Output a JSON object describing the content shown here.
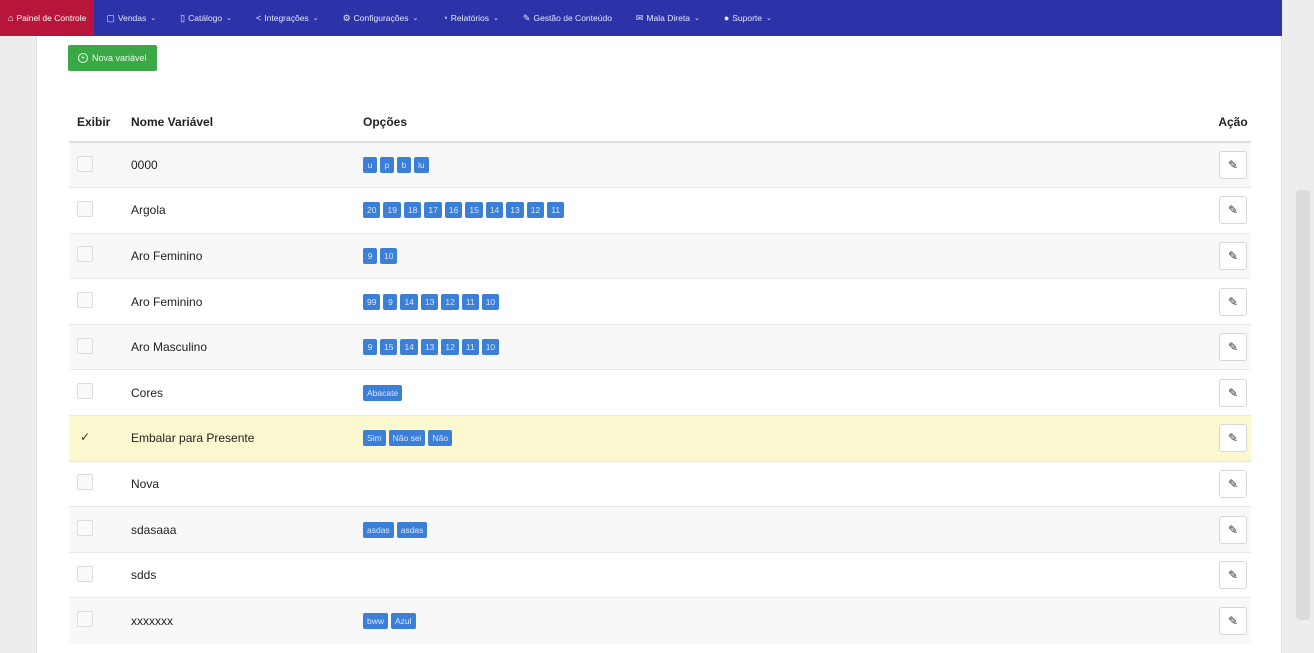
{
  "nav": [
    {
      "label": "Painel de Controle",
      "icon": "⌂",
      "icon_name": "home-icon",
      "active": true,
      "dropdown": false
    },
    {
      "label": "Vendas",
      "icon": "▢",
      "icon_name": "cart-icon",
      "active": false,
      "dropdown": true
    },
    {
      "label": "Catálogo",
      "icon": "▯",
      "icon_name": "book-icon",
      "active": false,
      "dropdown": true
    },
    {
      "label": "Integrações",
      "icon": "<",
      "icon_name": "share-icon",
      "active": false,
      "dropdown": true
    },
    {
      "label": "Configurações",
      "icon": "⚙",
      "icon_name": "gear-icon",
      "active": false,
      "dropdown": true
    },
    {
      "label": "Relatórios",
      "icon": "◔",
      "icon_name": "chart-icon",
      "active": false,
      "dropdown": true
    },
    {
      "label": "Gestão de Conteúdo",
      "icon": "✎",
      "icon_name": "edit-square-icon",
      "active": false,
      "dropdown": false
    },
    {
      "label": "Mala Direta",
      "icon": "✉",
      "icon_name": "mail-icon",
      "active": false,
      "dropdown": true
    },
    {
      "label": "Suporte",
      "icon": "●",
      "icon_name": "support-icon",
      "active": false,
      "dropdown": true
    }
  ],
  "new_button_label": "Nova variável",
  "table": {
    "headers": {
      "exibir": "Exibir",
      "nome": "Nome Variável",
      "opcoes": "Opções",
      "acao": "Ação"
    },
    "rows": [
      {
        "checked": false,
        "name": "0000",
        "options": [
          "u",
          "p",
          "b",
          "lu"
        ]
      },
      {
        "checked": false,
        "name": "Argola",
        "options": [
          "20",
          "19",
          "18",
          "17",
          "16",
          "15",
          "14",
          "13",
          "12",
          "11"
        ]
      },
      {
        "checked": false,
        "name": "Aro Feminino",
        "options": [
          "9",
          "10"
        ]
      },
      {
        "checked": false,
        "name": "Aro Feminino",
        "options": [
          "99",
          "9",
          "14",
          "13",
          "12",
          "11",
          "10"
        ]
      },
      {
        "checked": false,
        "name": "Aro Masculino",
        "options": [
          "9",
          "15",
          "14",
          "13",
          "12",
          "11",
          "10"
        ]
      },
      {
        "checked": false,
        "name": "Cores",
        "options": [
          "Abacate"
        ]
      },
      {
        "checked": true,
        "highlight": true,
        "name": "Embalar para Presente",
        "options": [
          "Sim",
          "Não sei",
          "Não"
        ]
      },
      {
        "checked": false,
        "name": "Nova",
        "options": []
      },
      {
        "checked": false,
        "name": "sdasaaa",
        "options": [
          "asdas",
          "asdas"
        ]
      },
      {
        "checked": false,
        "name": "sdds",
        "options": []
      },
      {
        "checked": false,
        "name": "xxxxxxx",
        "options": [
          "bww",
          "Azul"
        ]
      }
    ]
  },
  "colors": {
    "nav_bg": "#2c32a8",
    "nav_active": "#b7153b",
    "chip": "#3b7fd6",
    "new_button": "#3aa844",
    "highlight_row": "#fbf8d0"
  }
}
